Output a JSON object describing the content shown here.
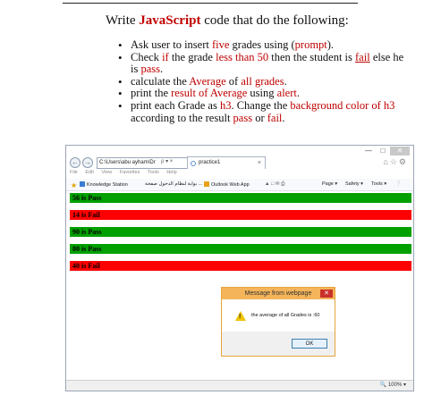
{
  "assignment": {
    "title_prefix": "Write",
    "title_keyword": "JavaScript",
    "title_suffix": "code that do the following:",
    "items": [
      {
        "a": "Ask user to insert ",
        "b": "five",
        "c": " grades using (",
        "d": "prompt",
        "e": ")."
      },
      {
        "a": "Check ",
        "b": "if",
        "c": " the grade ",
        "d": "less than 50",
        "e": " then the student is ",
        "f": "fail",
        "g": " else he is ",
        "h": "pass",
        "i": "."
      },
      {
        "a": "calculate the ",
        "b": "Average",
        "c": " of ",
        "d": "all grades",
        "e": "."
      },
      {
        "a": "print the ",
        "b": "result of Average",
        "c": " using ",
        "d": "alert",
        "e": "."
      },
      {
        "a": "print each Grade as ",
        "b": "h3",
        "c": ". Change the ",
        "d": "background color of h3",
        "e": " according to the result ",
        "f": "pass",
        "g": " or ",
        "h": "fail",
        "i": "."
      }
    ]
  },
  "browser": {
    "address": "C:\\Users\\abu ayham\\Dr",
    "address_controls": "ρ ▾ ×",
    "tab_title": "practice1",
    "menu": [
      "File",
      "Edit",
      "View",
      "Favorites",
      "Tools",
      "Help"
    ],
    "favorites": [
      {
        "label": "Knowledge Station"
      },
      {
        "label": "بوابة لنظام الدخول صفحة ..."
      },
      {
        "label": "Outlook Web App"
      }
    ],
    "commands": [
      "Page ▾",
      "Safety ▾",
      "Tools ▾"
    ],
    "zoom": "100%",
    "colors": {
      "pass": "#00a000",
      "fail": "#ff0000"
    }
  },
  "grades": [
    {
      "text": "56 is Pass",
      "status": "pass"
    },
    {
      "text": "14 is Fail",
      "status": "fail"
    },
    {
      "text": "90 is Pass",
      "status": "pass"
    },
    {
      "text": "80 is Pass",
      "status": "pass"
    },
    {
      "text": "40 is Fail",
      "status": "fail"
    }
  ],
  "dialog": {
    "title": "Message from webpage",
    "message": "the average of all Grades is :60",
    "ok_label": "OK"
  }
}
